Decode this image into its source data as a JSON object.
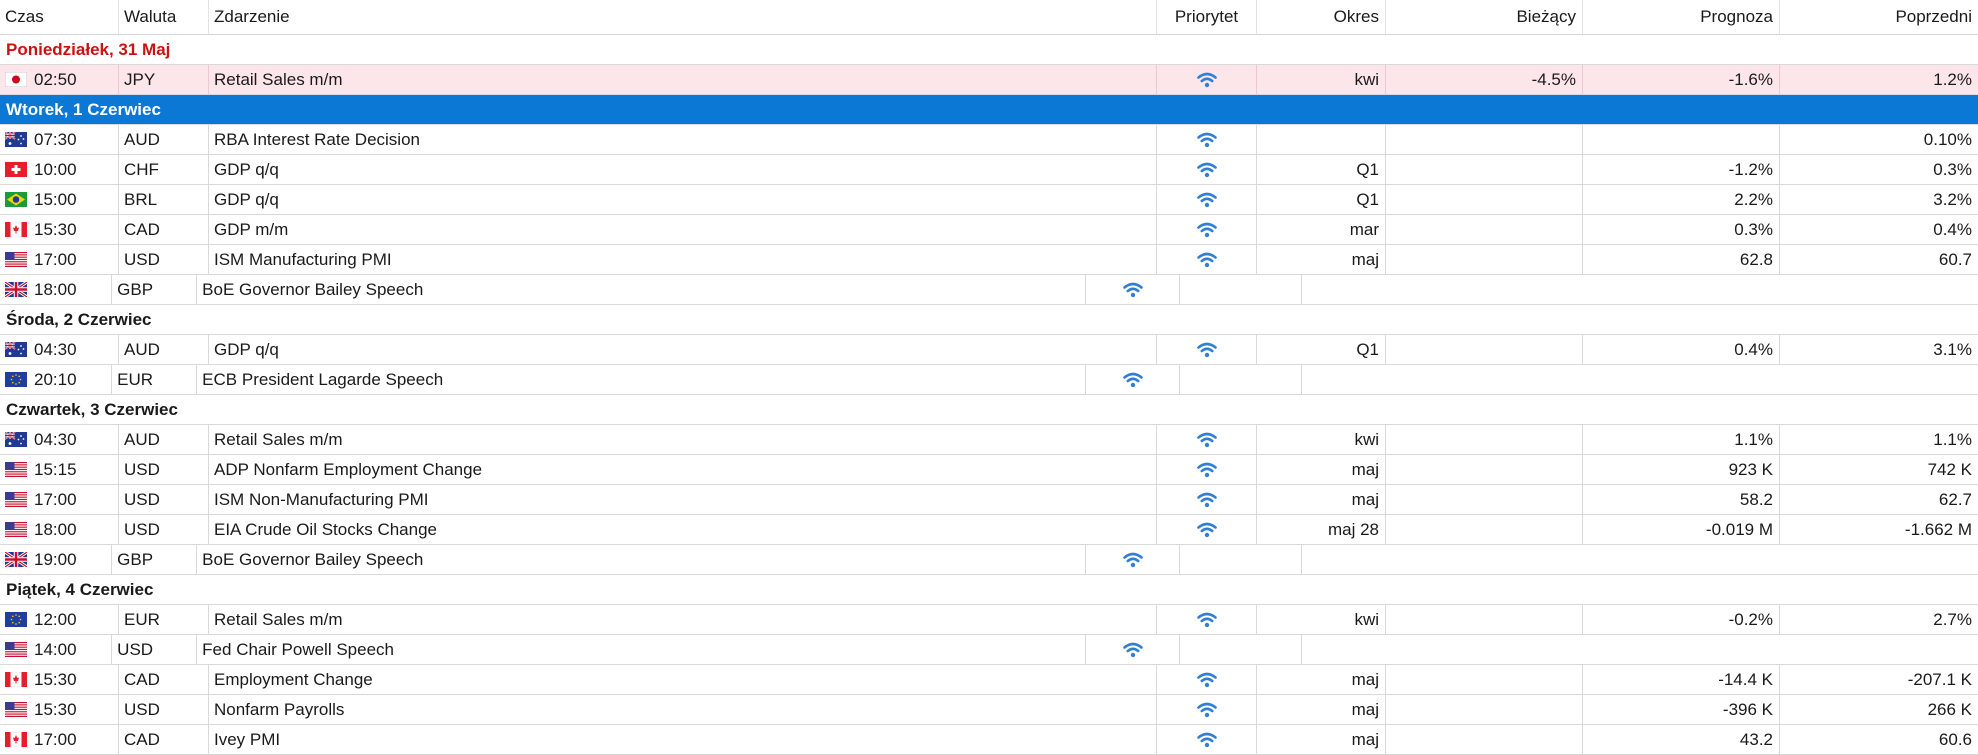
{
  "headers": {
    "czas": "Czas",
    "waluta": "Waluta",
    "zdarzenie": "Zdarzenie",
    "priorytet": "Priorytet",
    "okres": "Okres",
    "biezacy": "Bieżący",
    "prognoza": "Prognoza",
    "poprzedni": "Poprzedni"
  },
  "colors": {
    "today_header": "#cc1111",
    "selected_header": "#0a78d4",
    "highlight_row": "#fde6ea",
    "signal_icon": "#2f7fd6"
  },
  "days": [
    {
      "label": "Poniedziałek, 31 Maj",
      "style": "today",
      "events": [
        {
          "time": "02:50",
          "flag": "jp-flag-icon",
          "currency": "JPY",
          "event": "Retail Sales m/m",
          "period": "kwi",
          "actual": "-4.5%",
          "forecast": "-1.6%",
          "previous": "1.2%",
          "highlight": true
        }
      ]
    },
    {
      "label": "Wtorek, 1 Czerwiec",
      "style": "selected",
      "events": [
        {
          "time": "07:30",
          "flag": "au-flag-icon",
          "currency": "AUD",
          "event": "RBA Interest Rate Decision",
          "period": "",
          "actual": "",
          "forecast": "",
          "previous": "0.10%"
        },
        {
          "time": "10:00",
          "flag": "ch-flag-icon",
          "currency": "CHF",
          "event": "GDP q/q",
          "period": "Q1",
          "actual": "",
          "forecast": "-1.2%",
          "previous": "0.3%"
        },
        {
          "time": "15:00",
          "flag": "br-flag-icon",
          "currency": "BRL",
          "event": "GDP q/q",
          "period": "Q1",
          "actual": "",
          "forecast": "2.2%",
          "previous": "3.2%"
        },
        {
          "time": "15:30",
          "flag": "ca-flag-icon",
          "currency": "CAD",
          "event": "GDP m/m",
          "period": "mar",
          "actual": "",
          "forecast": "0.3%",
          "previous": "0.4%"
        },
        {
          "time": "17:00",
          "flag": "us-flag-icon",
          "currency": "USD",
          "event": "ISM Manufacturing PMI",
          "period": "maj",
          "actual": "",
          "forecast": "62.8",
          "previous": "60.7"
        },
        {
          "time": "18:00",
          "flag": "gb-flag-icon",
          "currency": "GBP",
          "event": "BoE Governor Bailey Speech",
          "period": "",
          "actual": "",
          "forecast": "",
          "previous": "",
          "speech": true
        }
      ]
    },
    {
      "label": "Środa, 2 Czerwiec",
      "style": "normal",
      "events": [
        {
          "time": "04:30",
          "flag": "au-flag-icon",
          "currency": "AUD",
          "event": "GDP q/q",
          "period": "Q1",
          "actual": "",
          "forecast": "0.4%",
          "previous": "3.1%"
        },
        {
          "time": "20:10",
          "flag": "eu-flag-icon",
          "currency": "EUR",
          "event": "ECB President Lagarde Speech",
          "period": "",
          "actual": "",
          "forecast": "",
          "previous": "",
          "speech": true
        }
      ]
    },
    {
      "label": "Czwartek, 3 Czerwiec",
      "style": "normal",
      "events": [
        {
          "time": "04:30",
          "flag": "au-flag-icon",
          "currency": "AUD",
          "event": "Retail Sales m/m",
          "period": "kwi",
          "actual": "",
          "forecast": "1.1%",
          "previous": "1.1%"
        },
        {
          "time": "15:15",
          "flag": "us-flag-icon",
          "currency": "USD",
          "event": "ADP Nonfarm Employment Change",
          "period": "maj",
          "actual": "",
          "forecast": "923 K",
          "previous": "742 K"
        },
        {
          "time": "17:00",
          "flag": "us-flag-icon",
          "currency": "USD",
          "event": "ISM Non-Manufacturing PMI",
          "period": "maj",
          "actual": "",
          "forecast": "58.2",
          "previous": "62.7"
        },
        {
          "time": "18:00",
          "flag": "us-flag-icon",
          "currency": "USD",
          "event": "EIA Crude Oil Stocks Change",
          "period": "maj 28",
          "actual": "",
          "forecast": "-0.019 M",
          "previous": "-1.662 M"
        },
        {
          "time": "19:00",
          "flag": "gb-flag-icon",
          "currency": "GBP",
          "event": "BoE Governor Bailey Speech",
          "period": "",
          "actual": "",
          "forecast": "",
          "previous": "",
          "speech": true
        }
      ]
    },
    {
      "label": "Piątek, 4 Czerwiec",
      "style": "normal",
      "events": [
        {
          "time": "12:00",
          "flag": "eu-flag-icon",
          "currency": "EUR",
          "event": "Retail Sales m/m",
          "period": "kwi",
          "actual": "",
          "forecast": "-0.2%",
          "previous": "2.7%"
        },
        {
          "time": "14:00",
          "flag": "us-flag-icon",
          "currency": "USD",
          "event": "Fed Chair Powell Speech",
          "period": "",
          "actual": "",
          "forecast": "",
          "previous": "",
          "speech": true
        },
        {
          "time": "15:30",
          "flag": "ca-flag-icon",
          "currency": "CAD",
          "event": "Employment Change",
          "period": "maj",
          "actual": "",
          "forecast": "-14.4 K",
          "previous": "-207.1 K"
        },
        {
          "time": "15:30",
          "flag": "us-flag-icon",
          "currency": "USD",
          "event": "Nonfarm Payrolls",
          "period": "maj",
          "actual": "",
          "forecast": "-396 K",
          "previous": "266 K"
        },
        {
          "time": "17:00",
          "flag": "ca-flag-icon",
          "currency": "CAD",
          "event": "Ivey PMI",
          "period": "maj",
          "actual": "",
          "forecast": "43.2",
          "previous": "60.6"
        }
      ]
    }
  ]
}
